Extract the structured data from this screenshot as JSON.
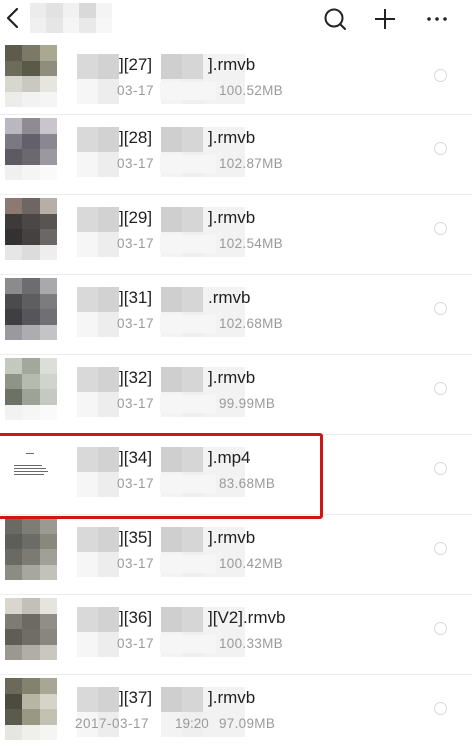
{
  "header": {
    "back_icon": "chevron-left-icon",
    "title": "",
    "actions": [
      "search-icon",
      "plus-icon",
      "more-icon"
    ]
  },
  "files": [
    {
      "ep": "][27]",
      "ext": "].rmvb",
      "date": "03-17",
      "time": "",
      "size": "100.52MB"
    },
    {
      "ep": "][28]",
      "ext": "].rmvb",
      "date": "03-17",
      "time": "",
      "size": "102.87MB"
    },
    {
      "ep": "][29]",
      "ext": "].rmvb",
      "date": "03-17",
      "time": "",
      "size": "102.54MB"
    },
    {
      "ep": "][31]",
      "ext": ".rmvb",
      "date": "03-17",
      "time": "",
      "size": "102.68MB"
    },
    {
      "ep": "][32]",
      "ext": "].rmvb",
      "date": "03-17",
      "time": "",
      "size": "99.99MB"
    },
    {
      "ep": "][34]",
      "ext": "].mp4",
      "date": "03-17",
      "time": "",
      "size": "83.68MB",
      "highlighted": true
    },
    {
      "ep": "][35]",
      "ext": "].rmvb",
      "date": "03-17",
      "time": "",
      "size": "100.42MB"
    },
    {
      "ep": "][36]",
      "ext": "][V2].rmvb",
      "date": "03-17",
      "time": "",
      "size": "100.33MB"
    },
    {
      "ep": "][37]",
      "ext": "].rmvb",
      "date": "2017-03-17",
      "time": "19:20",
      "size": "97.09MB"
    }
  ],
  "colors": {
    "highlight": "#d01515",
    "meta_text": "#9a9a9a",
    "divider": "#ededed"
  }
}
